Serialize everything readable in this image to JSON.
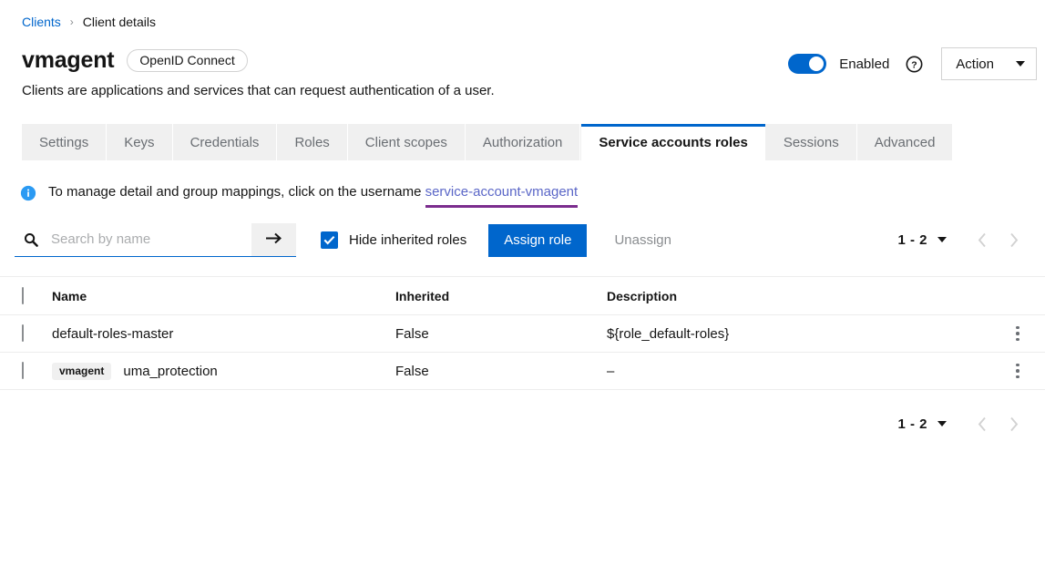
{
  "breadcrumb": {
    "parent": "Clients",
    "separator": "›",
    "current": "Client details"
  },
  "header": {
    "client_name": "vmagent",
    "protocol_badge": "OpenID Connect",
    "subtitle": "Clients are applications and services that can request authentication of a user.",
    "enabled_label": "Enabled",
    "enabled": true,
    "help_icon": "help-circle-icon",
    "action_label": "Action",
    "accent_color": "#0066cc"
  },
  "tabs": [
    {
      "label": "Settings",
      "active": false
    },
    {
      "label": "Keys",
      "active": false
    },
    {
      "label": "Credentials",
      "active": false
    },
    {
      "label": "Roles",
      "active": false
    },
    {
      "label": "Client scopes",
      "active": false
    },
    {
      "label": "Authorization",
      "active": false
    },
    {
      "label": "Service accounts roles",
      "active": true
    },
    {
      "label": "Sessions",
      "active": false
    },
    {
      "label": "Advanced",
      "active": false
    }
  ],
  "alert": {
    "icon": "info-circle-icon",
    "text_before": "To manage detail and group mappings, click on the username ",
    "link_text": "service-account-vmagent",
    "link_color": "#5a66c7",
    "underline_color": "#7b2d8e"
  },
  "toolbar": {
    "search_placeholder": "Search by name",
    "search_value": "",
    "search_icon": "search-icon",
    "submit_icon": "arrow-right-icon",
    "hide_inherited_label": "Hide inherited roles",
    "hide_inherited_checked": true,
    "assign_label": "Assign role",
    "unassign_label": "Unassign",
    "unassign_disabled": true
  },
  "pagination": {
    "range": "1 - 2",
    "prev_icon": "chevron-left-icon",
    "next_icon": "chevron-right-icon",
    "prev_disabled": true,
    "next_disabled": true
  },
  "table": {
    "columns": {
      "name": "Name",
      "inherited": "Inherited",
      "description": "Description"
    },
    "rows": [
      {
        "badge": "",
        "name": "default-roles-master",
        "inherited": "False",
        "description": "${role_default-roles}",
        "kebab": "kebab-menu-icon"
      },
      {
        "badge": "vmagent",
        "name": "uma_protection",
        "inherited": "False",
        "description": "–",
        "kebab": "kebab-menu-icon"
      }
    ]
  }
}
